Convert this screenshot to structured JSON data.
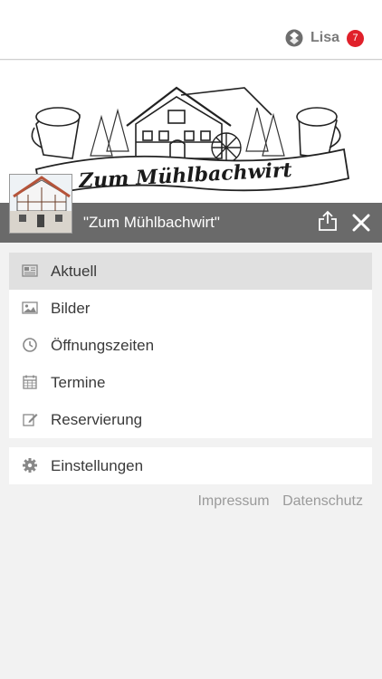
{
  "user": {
    "name": "Lisa",
    "badge_count": "7"
  },
  "restaurant": {
    "title": "\"Zum Mühlbachwirt\""
  },
  "hero": {
    "logo_lettering": "Zum Mühlbachwirt"
  },
  "menu": {
    "items": [
      {
        "label": "Aktuell",
        "icon": "news-icon",
        "active": true
      },
      {
        "label": "Bilder",
        "icon": "image-icon"
      },
      {
        "label": "Öffnungszeiten",
        "icon": "clock-icon"
      },
      {
        "label": "Termine",
        "icon": "calendar-icon"
      },
      {
        "label": "Reservierung",
        "icon": "edit-icon"
      }
    ],
    "settings": {
      "label": "Einstellungen",
      "icon": "gear-icon"
    }
  },
  "footer": {
    "impressum": "Impressum",
    "datenschutz": "Datenschutz"
  },
  "colors": {
    "badge": "#e0202a",
    "titlebar": "#6a6a6a",
    "active_item": "#e0e0e0"
  }
}
